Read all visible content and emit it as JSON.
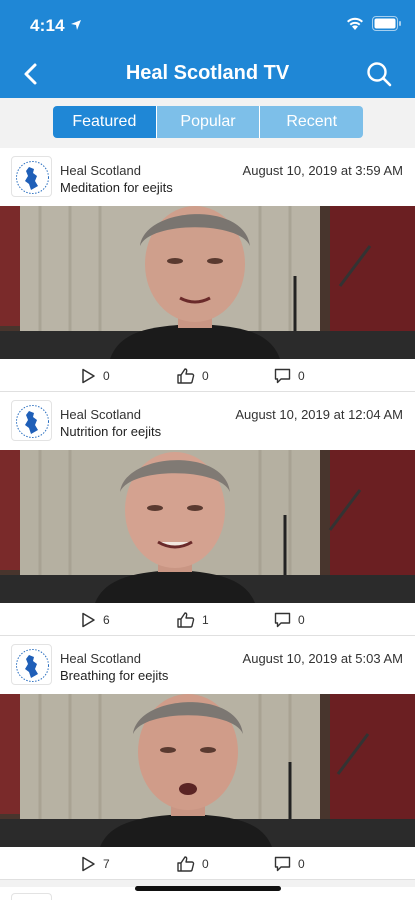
{
  "status": {
    "time": "4:14"
  },
  "header": {
    "title": "Heal Scotland TV"
  },
  "tabs": [
    {
      "label": "Featured",
      "active": true
    },
    {
      "label": "Popular",
      "active": false
    },
    {
      "label": "Recent",
      "active": false
    }
  ],
  "colors": {
    "header": "#1f87d6",
    "tab_inactive": "#7dbfe9",
    "background": "#f2f2f2"
  },
  "posts": [
    {
      "author": "Heal Scotland",
      "title": "Meditation for eejits",
      "date": "August 10, 2019 at 3:59 AM",
      "plays": "0",
      "likes": "0",
      "comments": "0"
    },
    {
      "author": "Heal Scotland",
      "title": "Nutrition for eejits",
      "date": "August 10, 2019 at 12:04 AM",
      "plays": "6",
      "likes": "1",
      "comments": "0"
    },
    {
      "author": "Heal Scotland",
      "title": "Breathing for eejits",
      "date": "August 10, 2019 at 5:03 AM",
      "plays": "7",
      "likes": "0",
      "comments": "0"
    }
  ],
  "icons": [
    "back-icon",
    "search-icon",
    "play-icon",
    "like-icon",
    "comment-icon",
    "wifi-icon",
    "battery-icon",
    "location-icon"
  ]
}
